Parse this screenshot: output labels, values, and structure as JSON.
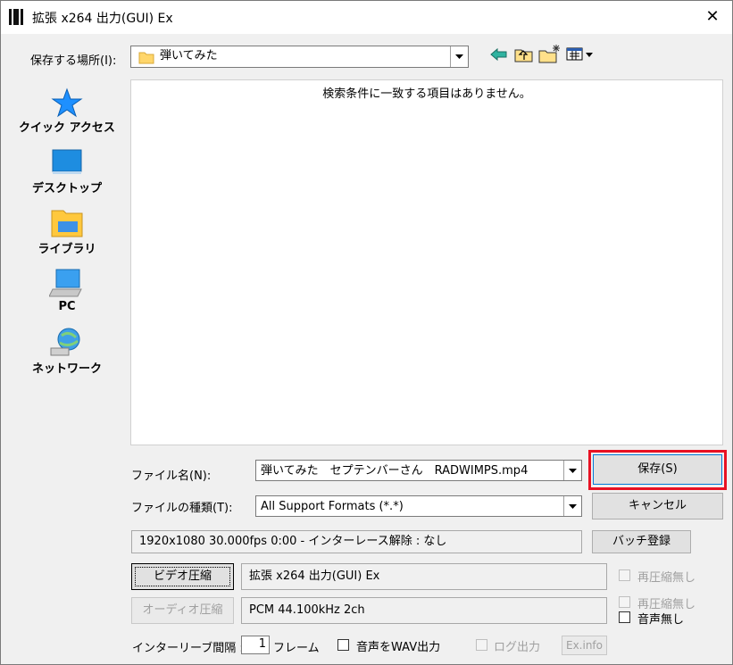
{
  "window": {
    "title": "拡張 x264 出力(GUI) Ex",
    "close_glyph": "✕"
  },
  "location": {
    "label": "保存する場所(I):",
    "value": "弾いてみた"
  },
  "toolbar": {
    "back_icon": "back-arrow-icon",
    "up_icon": "up-folder-icon",
    "new_folder_icon": "new-folder-icon",
    "view_icon": "view-menu-icon"
  },
  "places": [
    {
      "label": "クイック アクセス",
      "icon": "star-icon"
    },
    {
      "label": "デスクトップ",
      "icon": "desktop-icon"
    },
    {
      "label": "ライブラリ",
      "icon": "library-icon"
    },
    {
      "label": "PC",
      "icon": "pc-icon"
    },
    {
      "label": "ネットワーク",
      "icon": "network-icon"
    }
  ],
  "file_list": {
    "empty_message": "検索条件に一致する項目はありません。"
  },
  "filename": {
    "label": "ファイル名(N):",
    "value": "弾いてみた　セプテンバーさん　RADWIMPS.mp4"
  },
  "filetype": {
    "label": "ファイルの種類(T):",
    "value": "All Support Formats (*.*)"
  },
  "buttons": {
    "save": "保存(S)",
    "cancel": "キャンセル",
    "batch": "バッチ登録",
    "video_compress": "ビデオ圧縮",
    "audio_compress": "オーディオ圧縮",
    "exinfo": "Ex.info"
  },
  "info": {
    "video_info": "1920x1080  30.000fps  0:00  -  インターレース解除 : なし",
    "video_codec": "拡張 x264 出力(GUI) Ex",
    "audio_codec": "PCM 44.100kHz 2ch"
  },
  "options": {
    "video_no_recompress": "再圧縮無し",
    "audio_no_recompress": "再圧縮無し",
    "no_audio": "音声無し",
    "interleave_label": "インターリーブ間隔 :",
    "interleave_value": "1",
    "interleave_unit": "フレーム",
    "wav_output": "音声をWAV出力",
    "log_output": "ログ出力"
  },
  "colors": {
    "highlight_box": "#e81123",
    "folder": "#ffd66b",
    "accent": "#0078d7"
  }
}
